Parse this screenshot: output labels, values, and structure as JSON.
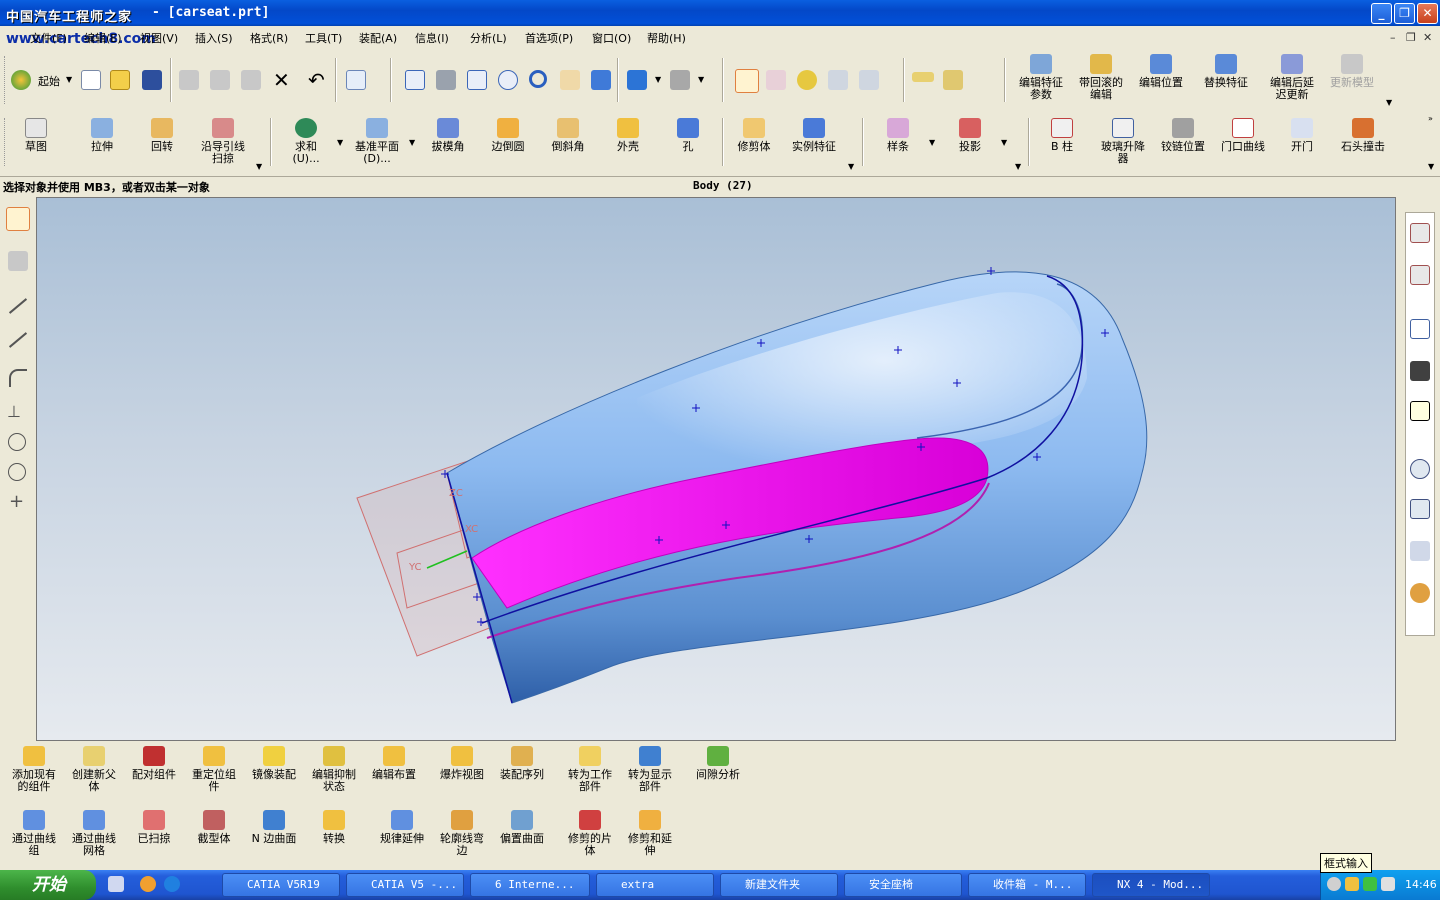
{
  "window": {
    "watermark": "中国汽车工程师之家",
    "title": "NX 4 - Modeling - [carseat.prt]",
    "title_visible": "- [carseat.prt]",
    "site": "www.cartech8.com"
  },
  "menu": [
    "文件(F)",
    "编辑(E)",
    "视图(V)",
    "插入(S)",
    "格式(R)",
    "工具(T)",
    "装配(A)",
    "信息(I)",
    "分析(L)",
    "首选项(P)",
    "窗口(O)",
    "帮助(H)"
  ],
  "toolbar1": {
    "start_label": "起始",
    "edit_feature": [
      "编辑特征",
      "参数"
    ],
    "rollback_edit": [
      "带回滚的",
      "编辑"
    ],
    "edit_position": "编辑位置",
    "replace_feature": "替换特征",
    "delay_update": [
      "编辑后延",
      "迟更新"
    ],
    "update_model": "更新模型"
  },
  "toolbar2": {
    "sketch": "草图",
    "extrude": "拉伸",
    "revolve": "回转",
    "sweep_guide": [
      "沿导引线",
      "扫掠"
    ],
    "unite": [
      "求和",
      "(U)..."
    ],
    "datum_plane": [
      "基准平面",
      "(D)..."
    ],
    "draft": "拔模角",
    "edge_blend": "边倒圆",
    "chamfer": "倒斜角",
    "shell": "外壳",
    "hole": "孔",
    "trim_body": "修剪体",
    "instance": "实例特征",
    "spline": "样条",
    "project": "投影",
    "b_pillar": "B 柱",
    "glass_lift": [
      "玻璃升降",
      "器"
    ],
    "hinge_position": "铰链位置",
    "door_curve": "门口曲线",
    "open_door": "开门",
    "head_impact": "石头撞击"
  },
  "status": {
    "prompt": "选择对象并使用 MB3，或者双击某一对象",
    "selection": "Body (27)"
  },
  "viewport": {
    "csys_label_y": "YC",
    "csys_label_x": "XC",
    "csys_label_z": "ZC",
    "highlight_color": "#e000e0",
    "body_color": "#7fb2ec"
  },
  "assembly_toolbar": [
    [
      "添加现有",
      "的组件"
    ],
    [
      "创建新父",
      "体"
    ],
    [
      "配对组件",
      ""
    ],
    [
      "重定位组",
      "件"
    ],
    [
      "镜像装配",
      ""
    ],
    [
      "编辑抑制",
      "状态"
    ],
    [
      "编辑布置",
      ""
    ],
    [
      "爆炸视图",
      ""
    ],
    [
      "装配序列",
      ""
    ],
    [
      "转为工作",
      "部件"
    ],
    [
      "转为显示",
      "部件"
    ],
    [
      "间隙分析",
      ""
    ]
  ],
  "surface_toolbar": [
    [
      "通过曲线",
      "组"
    ],
    [
      "通过曲线",
      "网格"
    ],
    [
      "已扫掠",
      ""
    ],
    [
      "截型体",
      ""
    ],
    [
      "N 边曲面",
      ""
    ],
    [
      "转换",
      ""
    ],
    [
      "规律延伸",
      ""
    ],
    [
      "轮廓线弯",
      "边"
    ],
    [
      "偏置曲面",
      ""
    ],
    [
      "修剪的片",
      "体"
    ],
    [
      "修剪和延",
      "伸"
    ]
  ],
  "taskbar": {
    "start": "开始",
    "tasks": [
      "CATIA V5R19",
      "CATIA V5 -...",
      "6 Interne...",
      "extra",
      "新建文件夹",
      "安全座椅",
      "收件箱 - M...",
      "NX 4 - Mod..."
    ],
    "time": "14:46",
    "tooltip": "框式输入"
  }
}
